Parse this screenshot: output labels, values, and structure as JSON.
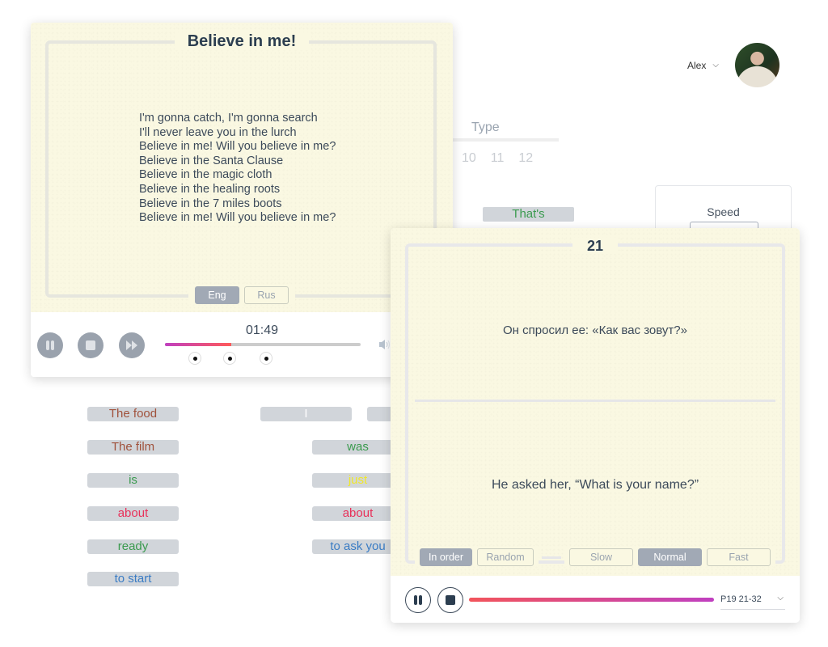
{
  "header": {
    "user_name": "Alex",
    "user_menu_icon": "chevron-down-icon",
    "avatar": "user-avatar-photo"
  },
  "background_panel": {
    "type_label": "Type",
    "numbers": [
      "10",
      "11",
      "12"
    ],
    "chip_thats": "That's",
    "speed_label": "Speed",
    "speed_option_partial": "Slow"
  },
  "word_chips": {
    "left": [
      {
        "text": "The food",
        "color": "#a0523c"
      },
      {
        "text": "The film",
        "color": "#a0523c"
      },
      {
        "text": "is",
        "color": "#3a9a4e"
      },
      {
        "text": "about",
        "color": "#e8315a"
      },
      {
        "text": "ready",
        "color": "#3a9a4e"
      },
      {
        "text": "to start",
        "color": "#3a7cc4"
      }
    ],
    "right": [
      {
        "text": "I",
        "color": "#ffffff"
      },
      {
        "text": "was",
        "color": "#3a9a4e"
      },
      {
        "text": "just",
        "color": "#f0e82a"
      },
      {
        "text": "about",
        "color": "#e8315a"
      },
      {
        "text": "to ask you",
        "color": "#3a7cc4"
      }
    ]
  },
  "song_card": {
    "title": "Believe in me!",
    "lyrics": [
      "I'm gonna catch, I'm gonna search",
      "I'll never leave you in the lurch",
      "Believe in me! Will you believe in me?",
      "Believe in the Santa Clause",
      "Believe in the magic cloth",
      "Believe in the healing roots",
      "Believe in the 7 miles boots",
      "Believe in me! Will you believe in me?"
    ],
    "languages": [
      {
        "label": "Eng",
        "active": true
      },
      {
        "label": "Rus",
        "active": false
      }
    ],
    "player": {
      "time": "01:49",
      "progress_percent": 34,
      "markers": 3,
      "buttons": [
        "pause-icon",
        "stop-icon",
        "fast-forward-icon"
      ],
      "volume_icon": "volume-icon"
    }
  },
  "phrase_card": {
    "number": "21",
    "russian": "Он спросил ее: «Как вас зовут?»",
    "english": "He asked her, “What is your name?”",
    "order_options": [
      {
        "label": "In order",
        "active": true
      },
      {
        "label": "Random",
        "active": false
      }
    ],
    "speed_options": [
      {
        "label": "Slow",
        "active": false
      },
      {
        "label": "Normal",
        "active": true
      },
      {
        "label": "Fast",
        "active": false
      }
    ],
    "player": {
      "progress_percent": 100,
      "buttons": [
        "pause-icon",
        "stop-icon"
      ],
      "range_select": "P19 21-32",
      "accent_start": "#f2545b",
      "accent_end": "#c040c0"
    }
  }
}
